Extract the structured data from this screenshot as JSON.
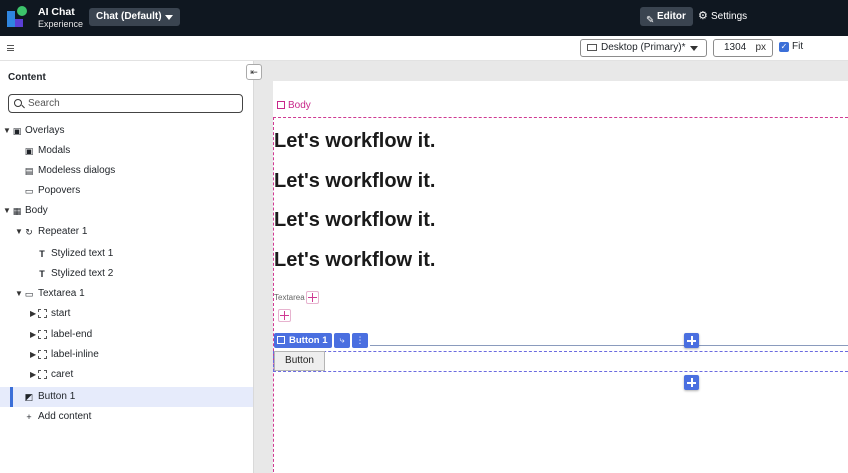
{
  "header": {
    "app_title": "AI Chat",
    "app_subtitle": "Experience",
    "chat_selector": "Chat (Default)",
    "editor_tab": "Editor",
    "settings_tab": "Settings"
  },
  "toolbar": {
    "device": "Desktop (Primary)*",
    "width_value": "1304",
    "width_unit": "px",
    "fit_label": "Fit",
    "fit_checked": true
  },
  "sidebar": {
    "title": "Content",
    "search_placeholder": "Search",
    "items": [
      {
        "label": "Overlays",
        "icon": "overlays-icon"
      },
      {
        "label": "Modals",
        "icon": "modal-icon"
      },
      {
        "label": "Modeless dialogs",
        "icon": "modeless-dialog-icon"
      },
      {
        "label": "Popovers",
        "icon": "popover-icon"
      },
      {
        "label": "Body",
        "icon": "body-icon"
      },
      {
        "label": "Repeater 1",
        "icon": "repeater-icon"
      },
      {
        "label": "Stylized text 1",
        "icon": "text-icon"
      },
      {
        "label": "Stylized text 2",
        "icon": "text-icon"
      },
      {
        "label": "Textarea 1",
        "icon": "folder-icon"
      },
      {
        "label": "start",
        "icon": "slot-icon"
      },
      {
        "label": "label-end",
        "icon": "slot-icon"
      },
      {
        "label": "label-inline",
        "icon": "slot-icon"
      },
      {
        "label": "caret",
        "icon": "slot-icon"
      },
      {
        "label": "Button 1",
        "icon": "button-icon",
        "selected": true
      },
      {
        "label": "Add content",
        "icon": "plus-icon"
      }
    ]
  },
  "canvas": {
    "body_label": "Body",
    "headings": [
      "Let's workflow it.",
      "Let's workflow it.",
      "Let's workflow it.",
      "Let's workflow it."
    ],
    "textarea_label": "Textarea",
    "button_tag": "Button 1",
    "button_text": "Button"
  },
  "colors": {
    "topbar": "#0f1720",
    "accent": "#4a6fe0",
    "body_outline": "#d03a93"
  }
}
